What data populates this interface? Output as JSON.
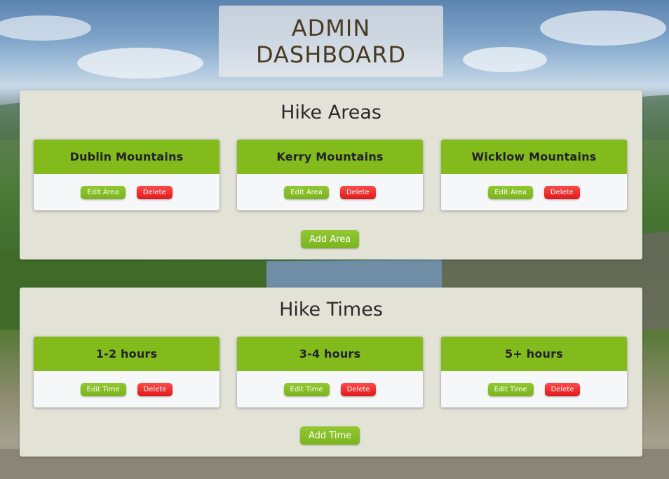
{
  "header": {
    "title_line1": "ADMIN",
    "title_line2": "DASHBOARD"
  },
  "areas": {
    "title": "Hike Areas",
    "cards": [
      {
        "name": "Dublin Mountains",
        "edit_label": "Edit Area",
        "delete_label": "Delete"
      },
      {
        "name": "Kerry Mountains",
        "edit_label": "Edit Area",
        "delete_label": "Delete"
      },
      {
        "name": "Wicklow Mountains",
        "edit_label": "Edit Area",
        "delete_label": "Delete"
      }
    ],
    "add_label": "Add Area"
  },
  "times": {
    "title": "Hike Times",
    "cards": [
      {
        "name": "1-2 hours",
        "edit_label": "Edit Time",
        "delete_label": "Delete"
      },
      {
        "name": "3-4 hours",
        "edit_label": "Edit Time",
        "delete_label": "Delete"
      },
      {
        "name": "5+ hours",
        "edit_label": "Edit Time",
        "delete_label": "Delete"
      }
    ],
    "add_label": "Add Time"
  },
  "colors": {
    "accent_green": "#84bb1c",
    "delete_red": "#e0191b",
    "panel_bg": "#e3e2d7",
    "title_text": "#4b3a22"
  }
}
